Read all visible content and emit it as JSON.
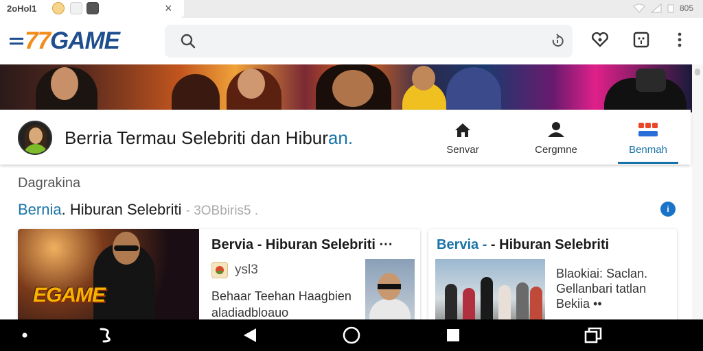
{
  "status_bar": {
    "time": "2oHol1",
    "clock": "805"
  },
  "toolbar": {
    "logo_seven": "77",
    "logo_word": "GAME"
  },
  "nav_card": {
    "title_main": "Berria Termau Selebriti dan Hibur",
    "title_accent": "an.",
    "tabs": [
      {
        "label": "Senvar",
        "icon": "home-icon"
      },
      {
        "label": "Cergmne",
        "icon": "person-icon"
      },
      {
        "label": "Benmah",
        "icon": "grid-icon",
        "active": true
      }
    ]
  },
  "section": {
    "caption": "Dagrakina",
    "heading_accent": "Bernia",
    "heading_main": ". Hiburan Selebriti",
    "heading_dim": "- 3OBbiris5 ."
  },
  "cards": [
    {
      "thumb_logo": "EGAME",
      "title": "Bervia - Hiburan Selebriti ···",
      "meta": "ysl3",
      "desc_line1": "Behaar Teehan Haagbien",
      "desc_line2": "aladiadbloauo"
    },
    {
      "title_accent": "Bervia -",
      "title_main": " - Hiburan Selebriti",
      "desc_line1": "Blaokiai: Saclan.",
      "desc_line2": "Gellanbari tatlan",
      "desc_line3": "Bekiia ••"
    }
  ],
  "colors": {
    "accent": "#1a73a8",
    "logo_orange": "#f28c1a",
    "logo_blue": "#1f4e8f",
    "navbar": "#000000"
  }
}
